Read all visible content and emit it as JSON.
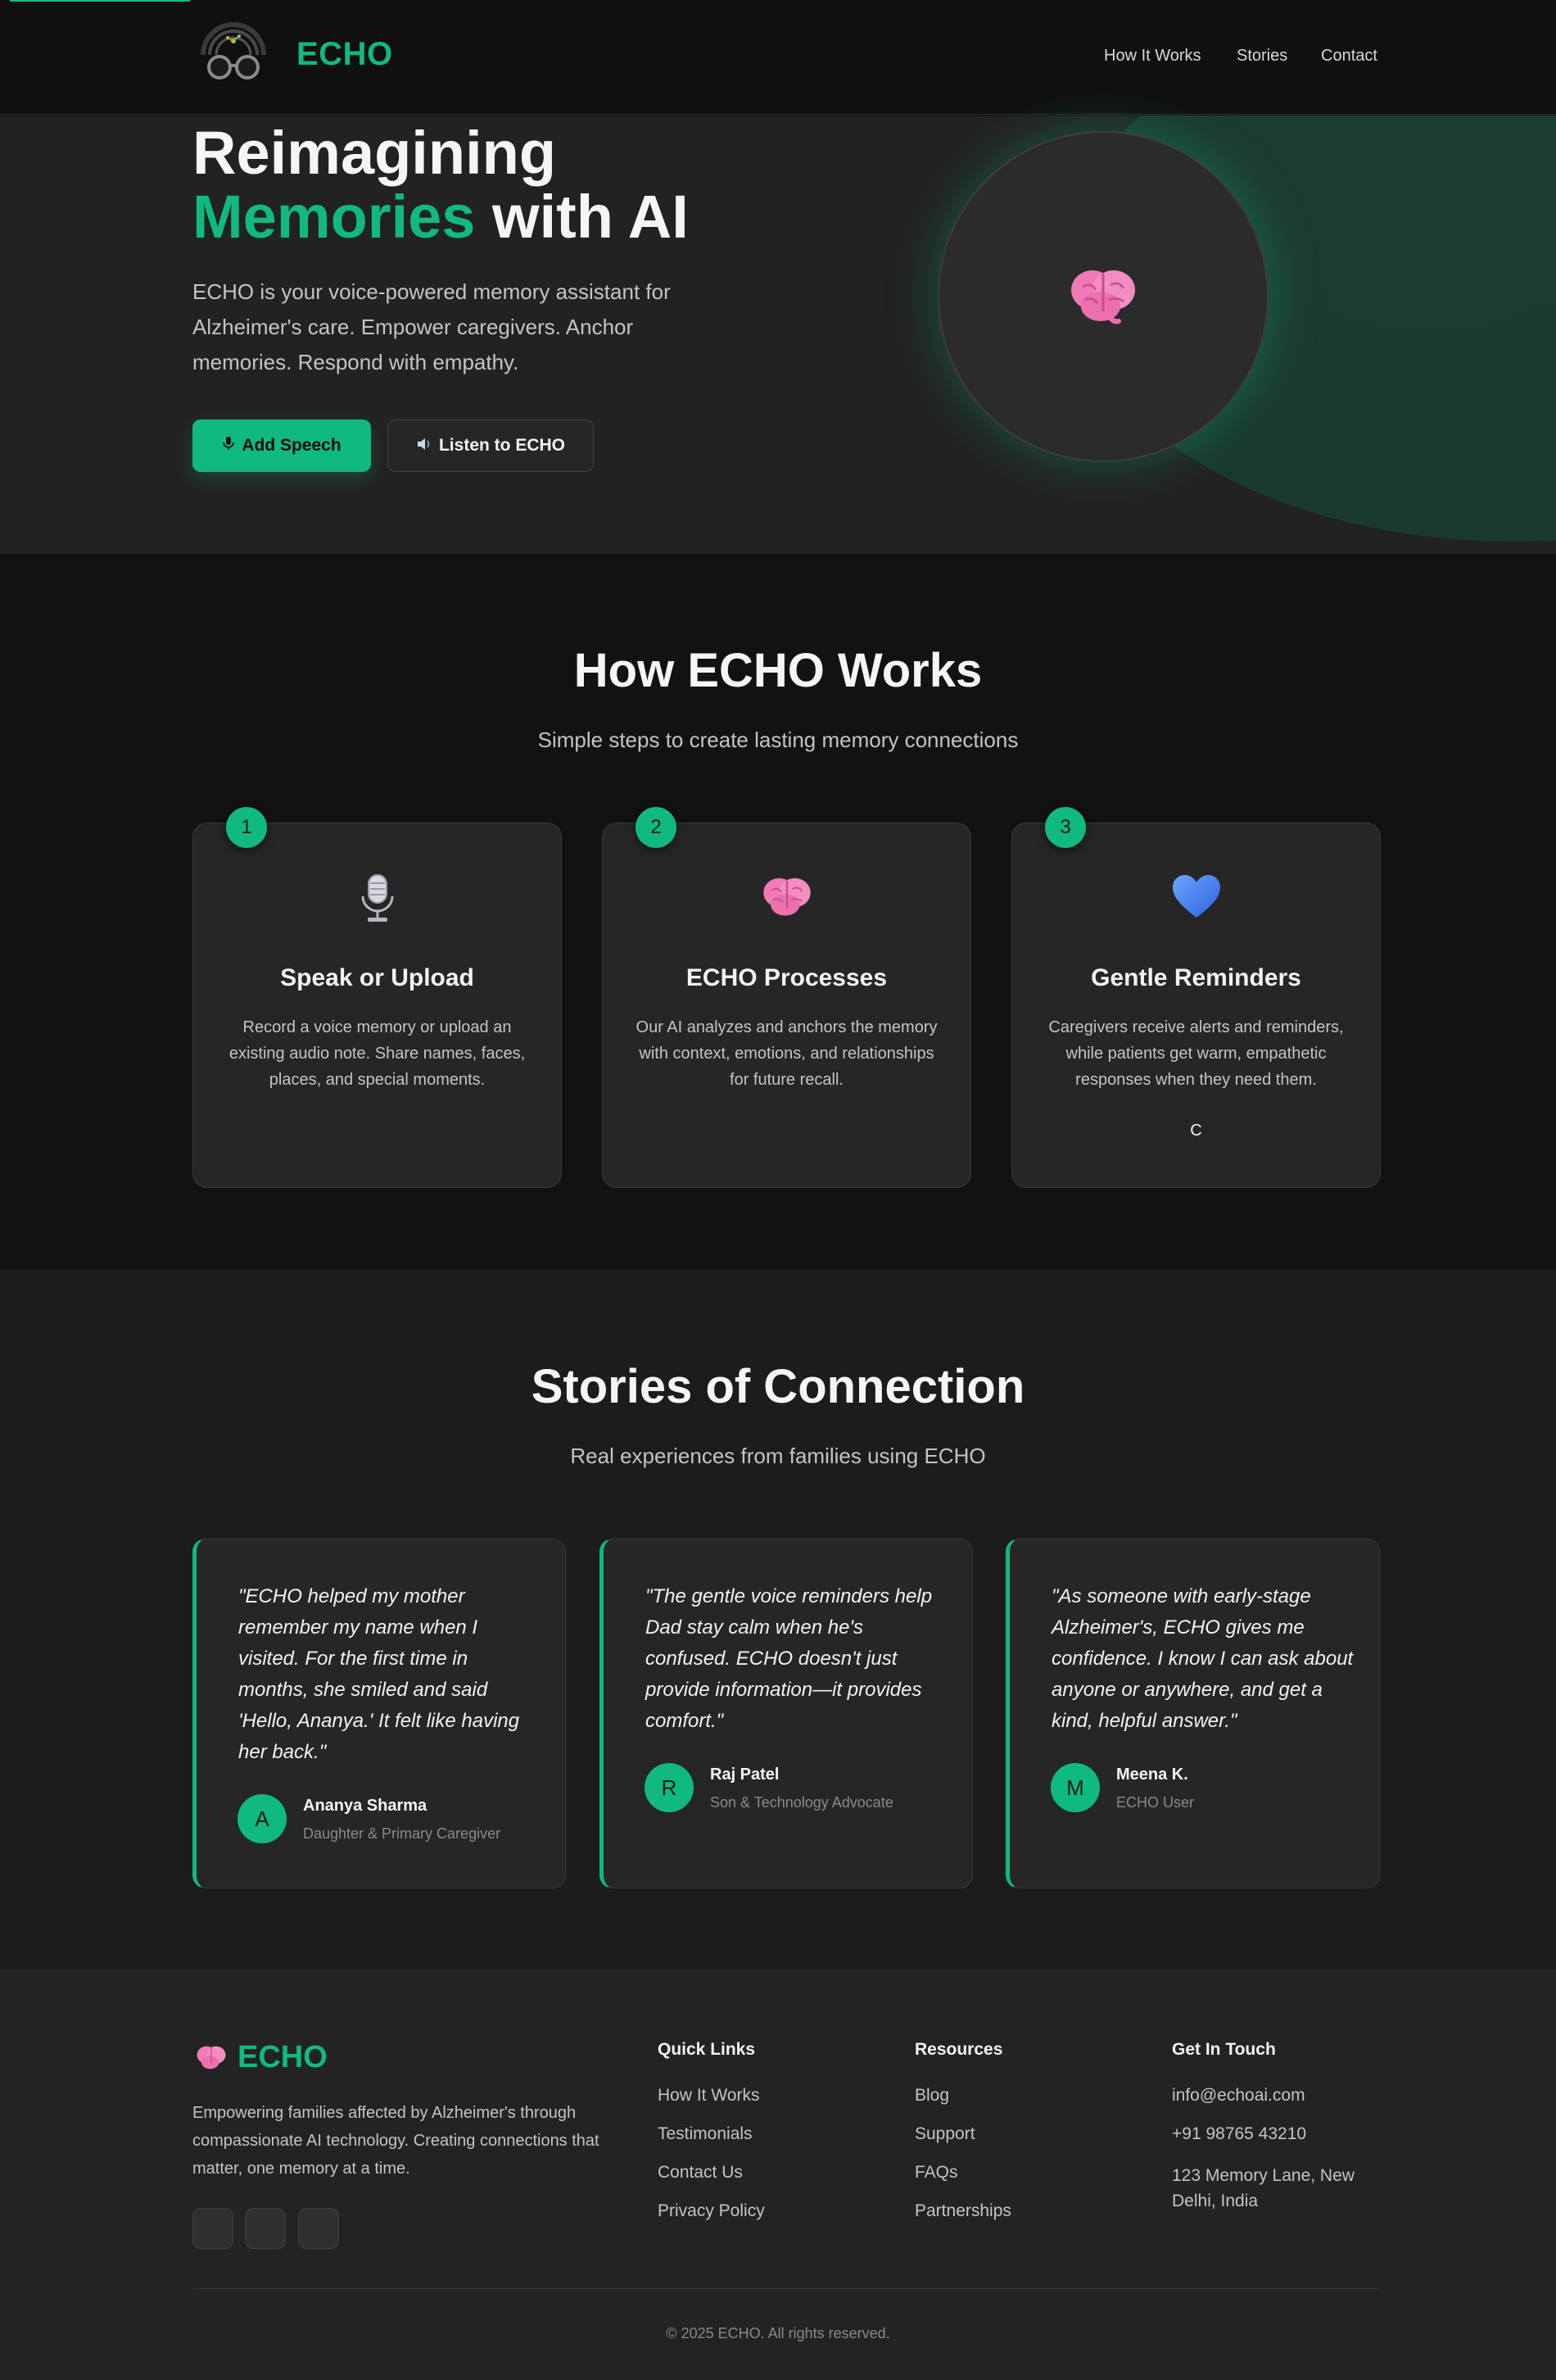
{
  "header": {
    "brand": "ECHO",
    "nav": [
      "How It Works",
      "Stories",
      "Contact"
    ]
  },
  "hero": {
    "title_line1": "Reimagining",
    "title_accent": "Memories",
    "title_rest": "with AI",
    "subtitle": "ECHO is your voice-powered memory assistant for Alzheimer's care. Empower caregivers. Anchor memories. Respond with empathy.",
    "primary_button": "Add Speech",
    "secondary_button": "Listen to ECHO",
    "primary_icon": "microphone-icon",
    "secondary_icon": "speaker-icon",
    "circle_icon": "brain-icon"
  },
  "how": {
    "title": "How ECHO Works",
    "subtitle": "Simple steps to create lasting memory connections",
    "steps": [
      {
        "number": "1",
        "icon": "microphone-icon",
        "title": "Speak or Upload",
        "description": "Record a voice memory or upload an existing audio note. Share names, faces, places, and special moments."
      },
      {
        "number": "2",
        "icon": "brain-icon",
        "title": "ECHO Processes",
        "description": "Our AI analyzes and anchors the memory with context, emotions, and relationships for future recall."
      },
      {
        "number": "3",
        "icon": "heart-icon",
        "title": "Gentle Reminders",
        "description": "Caregivers receive alerts and reminders, while patients get warm, empathetic responses when they need them.",
        "extra": "C"
      }
    ]
  },
  "stories": {
    "title": "Stories of Connection",
    "subtitle": "Real experiences from families using ECHO",
    "items": [
      {
        "quote": "\"ECHO helped my mother remember my name when I visited. For the first time in months, she smiled and said 'Hello, Ananya.' It felt like having her back.\"",
        "initial": "A",
        "name": "Ananya Sharma",
        "role": "Daughter & Primary Caregiver"
      },
      {
        "quote": "\"The gentle voice reminders help Dad stay calm when he's confused. ECHO doesn't just provide information—it provides comfort.\"",
        "initial": "R",
        "name": "Raj Patel",
        "role": "Son & Technology Advocate"
      },
      {
        "quote": "\"As someone with early-stage Alzheimer's, ECHO gives me confidence. I know I can ask about anyone or anywhere, and get a kind, helpful answer.\"",
        "initial": "M",
        "name": "Meena K.",
        "role": "ECHO User"
      }
    ]
  },
  "footer": {
    "brand": "ECHO",
    "description": "Empowering families affected by Alzheimer's through compassionate AI technology. Creating connections that matter, one memory at a time.",
    "columns": [
      {
        "title": "Quick Links",
        "links": [
          "How It Works",
          "Testimonials",
          "Contact Us",
          "Privacy Policy"
        ]
      },
      {
        "title": "Resources",
        "links": [
          "Blog",
          "Support",
          "FAQs",
          "Partnerships"
        ]
      },
      {
        "title": "Get In Touch",
        "links": [
          "info@echoai.com",
          "+91 98765 43210",
          "123 Memory Lane, New Delhi, India"
        ]
      }
    ],
    "copyright": "© 2025 ECHO. All rights reserved."
  },
  "colors": {
    "accent": "#10b981",
    "background": "#121212",
    "card": "#262626"
  }
}
